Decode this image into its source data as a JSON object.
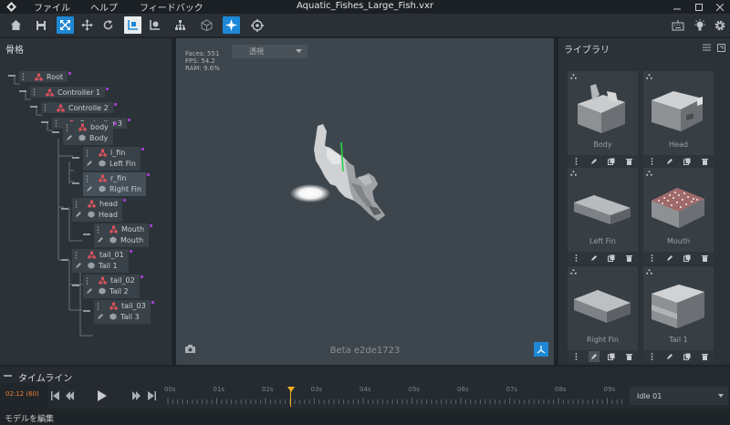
{
  "window": {
    "title": "Aquatic_Fishes_Large_Fish.vxr",
    "menu": [
      "ファイル",
      "ヘルプ",
      "フィードバック"
    ]
  },
  "colors": {
    "accent": "#1e88d6",
    "panel": "#2b3238",
    "bg": "#1f2428",
    "bone_icon": "#e0525c",
    "marker": "#f0b020",
    "keyframe_dot": "#a040c8"
  },
  "toolbar": {
    "left_icons": [
      "home-icon",
      "save-icon",
      "resize-icon",
      "move-icon",
      "rotate-icon",
      "pivot-icon",
      "attach-icon",
      "hierarchy-icon",
      "cube-icon",
      "sparkle-icon",
      "target-icon"
    ],
    "right_icons": [
      "keyboard-icon",
      "lightbulb-icon",
      "settings-icon"
    ]
  },
  "skeleton": {
    "title": "骨格",
    "nodes": [
      {
        "name": "Root",
        "sub": ""
      },
      {
        "name": "Controller 1",
        "sub": ""
      },
      {
        "name": "Controlle 2",
        "sub": ""
      },
      {
        "name": "Controller 3",
        "sub": ""
      },
      {
        "name": "body",
        "sub": "Body"
      },
      {
        "name": "l_fin",
        "sub": "Left Fin"
      },
      {
        "name": "r_fin",
        "sub": "Right Fin"
      },
      {
        "name": "head",
        "sub": "Head"
      },
      {
        "name": "Mouth",
        "sub": "Mouth"
      },
      {
        "name": "tail_01",
        "sub": "Tail 1"
      },
      {
        "name": "tail_02",
        "sub": "Tail 2"
      },
      {
        "name": "tail_03",
        "sub": "Tail 3"
      }
    ]
  },
  "viewport": {
    "stats": [
      "Faces: 551",
      "FPS: 54.2",
      "RAM: 9.6%"
    ],
    "view_mode": "透視",
    "version": "Beta e2de1723"
  },
  "library": {
    "title": "ライブラリ",
    "items": [
      {
        "label": "Body"
      },
      {
        "label": "Head"
      },
      {
        "label": "Left Fin"
      },
      {
        "label": "Mouth"
      },
      {
        "label": "Right Fin"
      },
      {
        "label": "Tail 1"
      }
    ]
  },
  "timeline": {
    "title": "タイムライン",
    "current_time": "02:12 (60)",
    "ticks": [
      "00s",
      "01s",
      "02s",
      "03s",
      "04s",
      "05s",
      "06s",
      "07s",
      "08s",
      "09s"
    ],
    "playhead_seconds": 2.5,
    "animation": "Idle 01"
  },
  "status": {
    "text": "モデルを編集"
  }
}
